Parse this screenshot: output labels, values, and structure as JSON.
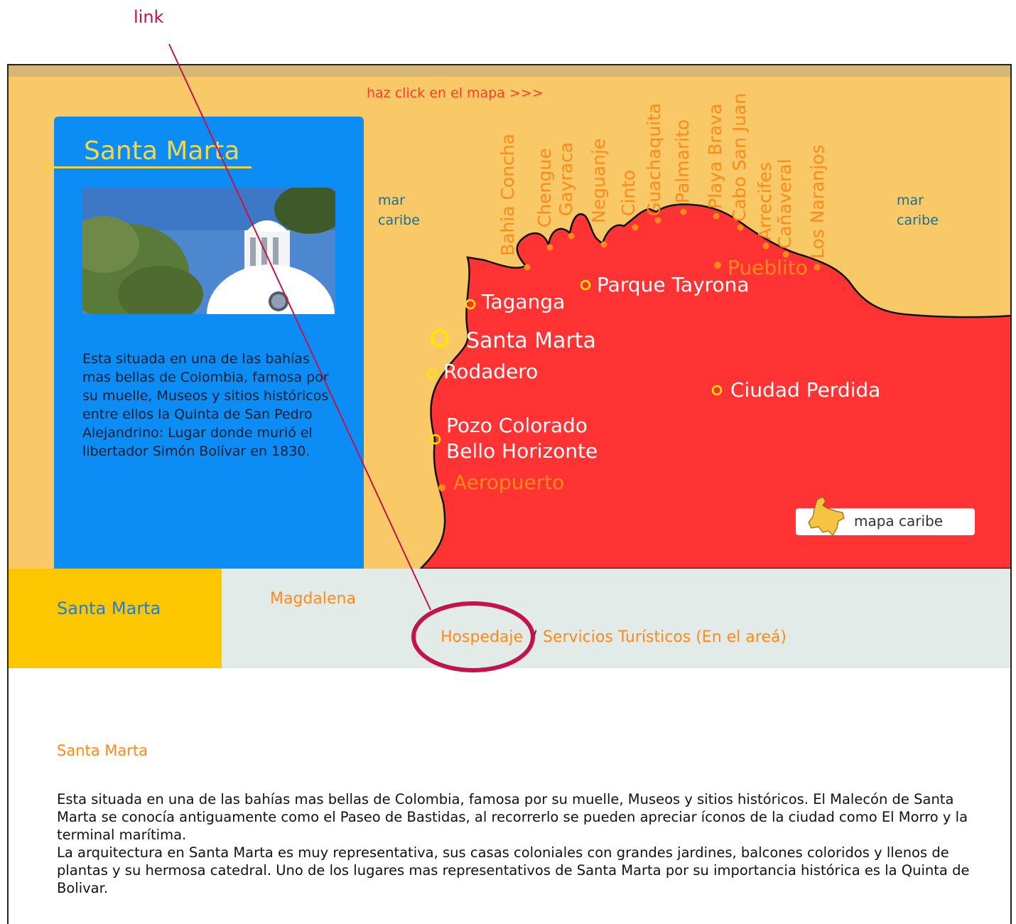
{
  "annotation": {
    "label": "link"
  },
  "map": {
    "hint": "haz click en el mapa >>>",
    "sea_left": "mar caribe",
    "sea_right": "mar caribe",
    "places": {
      "taganga": "Taganga",
      "santa_marta": "Santa Marta",
      "rodadero": "Rodadero",
      "pozo_colorado": "Pozo Colorado",
      "bello_horizonte": "Bello Horizonte",
      "aeropuerto": "Aeropuerto",
      "parque_tayrona": "Parque Tayrona",
      "pueblito": "Pueblito",
      "ciudad_perdida": "Ciudad Perdida"
    },
    "beaches": [
      "Bahia Concha",
      "Chengue",
      "Gayraca",
      "Neguanje",
      "Cinto",
      "Guachaquita",
      "Palmarito",
      "Playa Brava",
      "Cabo San Juan",
      "Arrecifes",
      "Cañaveral",
      "Los Naranjos"
    ],
    "mapa_caribe": "mapa caribe",
    "colors": {
      "land": "#ff3333",
      "sea": "#f9c867",
      "marker": "#ffe600"
    }
  },
  "card": {
    "title": "Santa Marta",
    "text": "Esta situada en una de las bahías mas bellas de Colombia, famosa por su muelle, Museos y sitios históricos entre ellos la Quinta de San Pedro Alejandrino: Lugar donde murió el libertador Simón Bolívar en 1830."
  },
  "nav": {
    "city": "Santa Marta",
    "region": "Magdalena",
    "hospedaje": "Hospedaje",
    "separator": "/",
    "servicios": "Servicios Turísticos (En el areá)"
  },
  "content": {
    "title": "Santa Marta",
    "paragraph1": "Esta situada en una de las bahías mas bellas de Colombia, famosa por su muelle, Museos y sitios históricos. El Malecón de Santa Marta se conocía antiguamente como el Paseo de Bastidas, al recorrerlo se pueden apreciar íconos de la ciudad como El Morro y la terminal marítima.",
    "paragraph2": "La arquitectura en Santa Marta es muy representativa, sus casas coloniales con grandes jardines, balcones coloridos y llenos de plantas y su hermosa catedral. Uno de los lugares mas representativos de Santa Marta por su importancia histórica es la Quinta de Bolivar."
  }
}
